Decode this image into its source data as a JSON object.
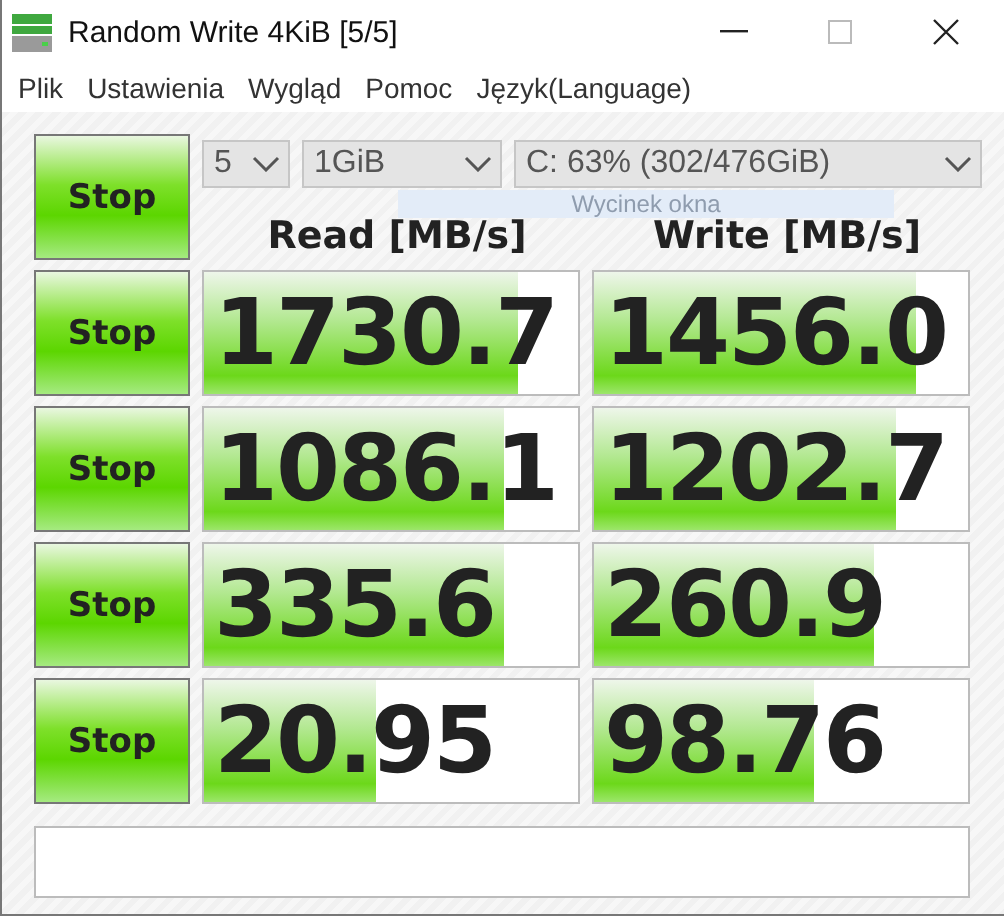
{
  "window": {
    "title": "Random Write 4KiB [5/5]"
  },
  "menu": [
    "Plik",
    "Ustawienia",
    "Wygląd",
    "Pomoc",
    "Język(Language)"
  ],
  "main_button": {
    "label": "Stop"
  },
  "selectors": [
    {
      "value": "5"
    },
    {
      "value": "1GiB"
    },
    {
      "value": "C: 63% (302/476GiB)"
    }
  ],
  "overlay_hint": "Wycinek okna",
  "headers": [
    "Read [MB/s]",
    "Write [MB/s]"
  ],
  "rows": [
    {
      "button": "Stop",
      "read": {
        "value": "1730.7",
        "level": 0.84
      },
      "write": {
        "value": "1456.0",
        "level": 0.86
      }
    },
    {
      "button": "Stop",
      "read": {
        "value": "1086.1",
        "level": 0.8
      },
      "write": {
        "value": "1202.7",
        "level": 0.81
      }
    },
    {
      "button": "Stop",
      "read": {
        "value": "335.6",
        "level": 0.8
      },
      "write": {
        "value": "260.9",
        "level": 0.75
      }
    },
    {
      "button": "Stop",
      "read": {
        "value": "20.95",
        "level": 0.46
      },
      "write": {
        "value": "98.76",
        "level": 0.59
      }
    }
  ]
}
